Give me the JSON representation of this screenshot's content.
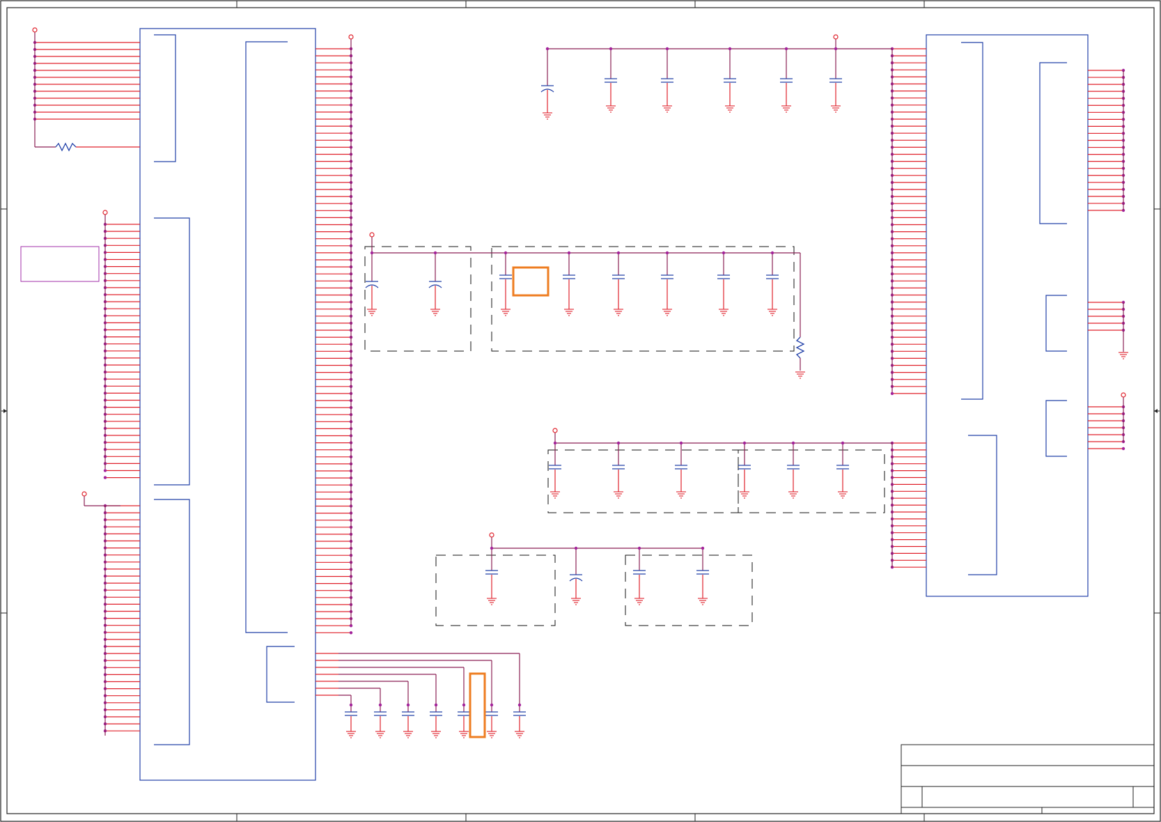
{
  "sheet": {
    "border_color": "#222222",
    "wire_color": "#8a1f54",
    "pin_color": "#e0202a",
    "component_color": "#2140a8",
    "junction_color": "#a3239a",
    "dashed_group_color": "#111111",
    "highlight_color": "#ee7d21",
    "note_color": "#a02fa8"
  },
  "icons": {
    "zone_marker_left": "arrow-right-icon",
    "zone_marker_right": "arrow-left-icon"
  }
}
